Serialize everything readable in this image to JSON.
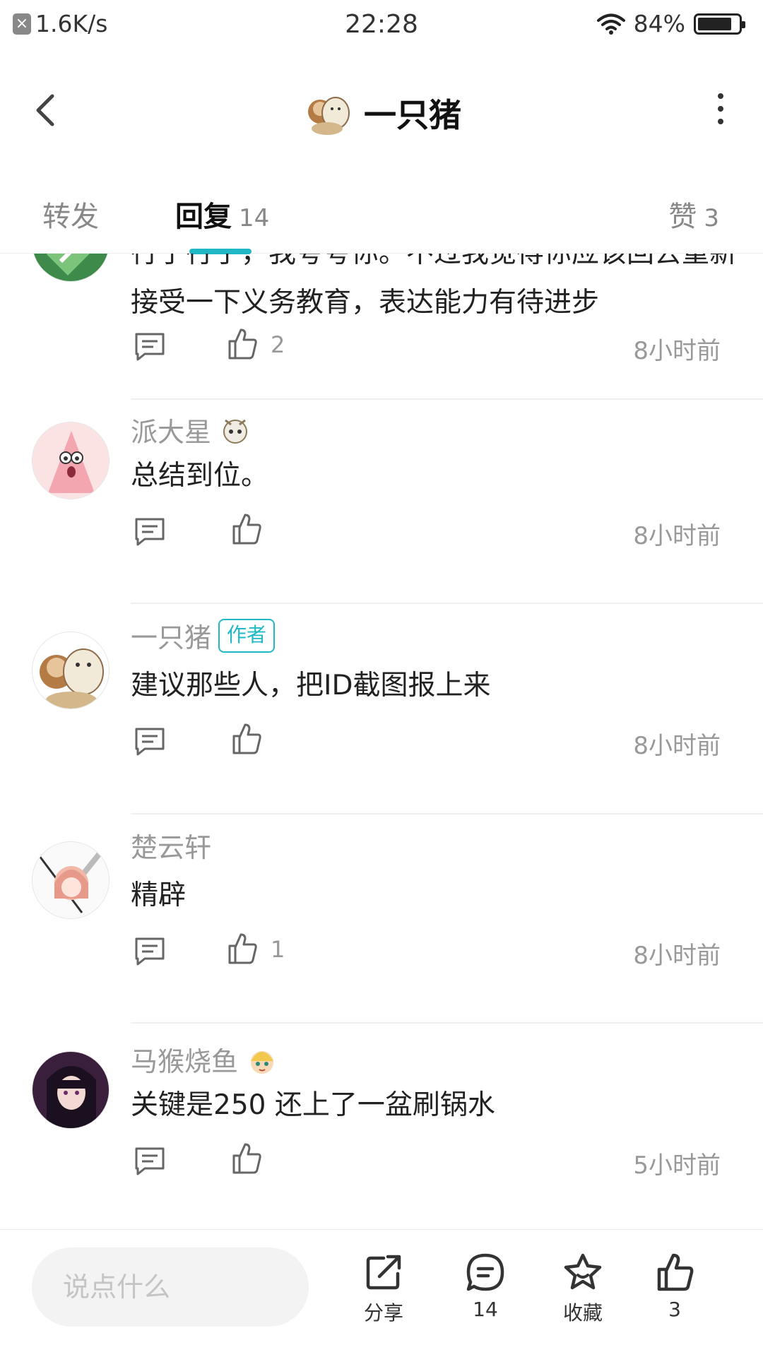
{
  "status": {
    "net_speed": "1.6K/s",
    "time": "22:28",
    "battery": "84%",
    "battery_level": 0.84
  },
  "header": {
    "title": "一只猪"
  },
  "tabs": {
    "forward": "转发",
    "reply": "回复",
    "reply_count": "14",
    "like": "赞",
    "like_count": "3"
  },
  "comments": [
    {
      "text": "行了行了，我夸夸你。不过我觉得你应该回去重新接受一下义务教育，表达能力有待进步",
      "likes": "2",
      "time": "8小时前"
    },
    {
      "username": "派大星",
      "text": "总结到位。",
      "likes": "",
      "time": "8小时前"
    },
    {
      "username": "一只猪",
      "badge": "作者",
      "text": "建议那些人，把ID截图报上来",
      "likes": "",
      "time": "8小时前"
    },
    {
      "username": "楚云轩",
      "text": "精辟",
      "likes": "1",
      "time": "8小时前"
    },
    {
      "username": "马猴烧鱼",
      "text": "关键是250 还上了一盆刷锅水",
      "likes": "",
      "time": "5小时前"
    }
  ],
  "bottom": {
    "placeholder": "说点什么",
    "share": "分享",
    "comments": "14",
    "favorite": "收藏",
    "likes": "3"
  },
  "colors": {
    "accent": "#1fb8c4",
    "muted_text": "#999999",
    "main_text": "#222222"
  }
}
